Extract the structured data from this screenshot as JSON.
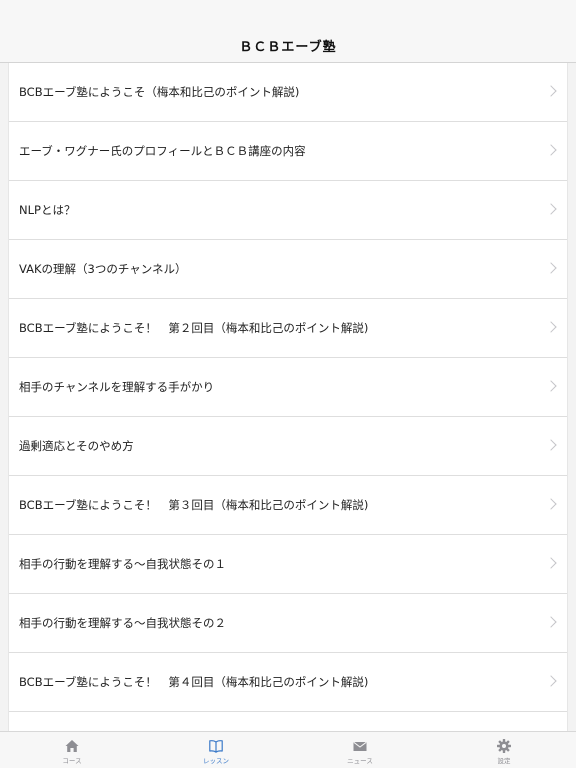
{
  "nav": {
    "title": "ＢＣＢエーブ塾"
  },
  "lessons": [
    "BCBエーブ塾にようこそ（梅本和比己のポイント解説)",
    "エーブ・ワグナー氏のプロフィールとＢＣＢ講座の内容",
    "NLPとは？",
    "VAKの理解（3つのチャンネル）",
    "BCBエーブ塾にようこそ！　第２回目（梅本和比己のポイント解説)",
    "相手のチャンネルを理解する手がかり",
    "過剰適応とそのやめ方",
    "BCBエーブ塾にようこそ！　第３回目（梅本和比己のポイント解説)",
    "相手の行動を理解する〜自我状態その１",
    "相手の行動を理解する〜自我状態その２",
    "BCBエーブ塾にようこそ！　第４回目（梅本和比己のポイント解説)"
  ],
  "tabs": [
    {
      "label": "コース",
      "icon": "house-icon",
      "active": false
    },
    {
      "label": "レッスン",
      "icon": "book-icon",
      "active": true
    },
    {
      "label": "ニュース",
      "icon": "envelope-icon",
      "active": false
    },
    {
      "label": "設定",
      "icon": "gear-icon",
      "active": false
    }
  ],
  "colors": {
    "accent": "#3b7ac9",
    "inactive": "#8e8e93",
    "chevron": "#c4c4c8"
  }
}
